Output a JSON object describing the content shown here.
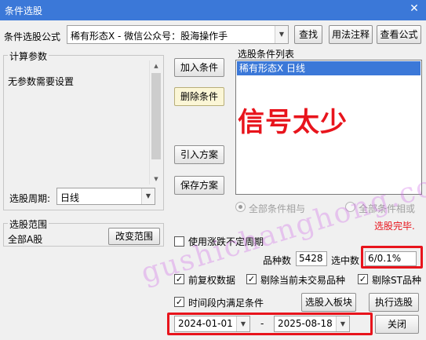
{
  "window": {
    "title": "条件选股",
    "close_glyph": "✕"
  },
  "formula_row": {
    "label": "条件选股公式",
    "selected": "稀有形态X  -  微信公众号：股海操作手",
    "find_button": "查找",
    "usage_button": "用法注释",
    "view_button": "查看公式"
  },
  "params": {
    "legend": "计算参数",
    "text": "无参数需要设置",
    "period_label": "选股周期:",
    "period_value": "日线"
  },
  "buttons": {
    "add_condition": "加入条件",
    "delete_condition": "删除条件",
    "import_plan": "引入方案",
    "save_plan": "保存方案",
    "change_range": "改变范围",
    "select_to_block": "选股入板块",
    "execute": "执行选股",
    "close": "关闭"
  },
  "condition_list": {
    "legend": "选股条件列表",
    "items": [
      "稀有形态X  日线"
    ]
  },
  "logic": {
    "and_label": "全部条件相与",
    "or_label": "全部条件相或"
  },
  "status": {
    "done": "选股完毕."
  },
  "range": {
    "legend": "选股范围",
    "value": "全部A股"
  },
  "options": {
    "variable_period": "使用涨跌不定周期",
    "adjusted_data": "前复权数据",
    "exclude_untraded": "剔除当前未交易品种",
    "exclude_st": "剔除ST品种",
    "period_satisfy": "时间段内满足条件"
  },
  "stats": {
    "count_label": "品种数",
    "count_value": "5428",
    "selected_label": "选中数",
    "selected_value": "6/0.1%"
  },
  "dates": {
    "start": "2024-01-01",
    "separator": "-",
    "end": "2025-08-18"
  },
  "overlay": {
    "annotation": "信号太少",
    "watermark": "gushichanghong.com"
  },
  "colors": {
    "accent": "#3b78d8",
    "annotation": "#e8141c",
    "status_red": "#e8141c"
  }
}
